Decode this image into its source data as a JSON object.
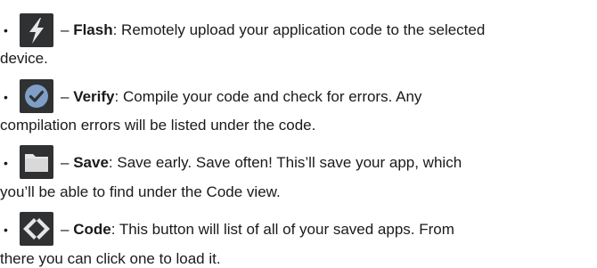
{
  "items": [
    {
      "icon": "lightning-bolt-icon",
      "dash": "–",
      "name": "Flash",
      "line1_rest": ": Remotely upload your application code to the selected",
      "line2": "device."
    },
    {
      "icon": "checkmark-circle-icon",
      "dash": "–",
      "name": "Verify",
      "line1_rest": ": Compile your code and check for errors. Any",
      "line2": "compilation errors will be listed under the code."
    },
    {
      "icon": "folder-icon",
      "dash": "–",
      "name": "Save",
      "line1_rest": ": Save early. Save often! This’ll save your app, which",
      "line2": "you’ll be able to find under the Code view."
    },
    {
      "icon": "code-brackets-icon",
      "dash": "–",
      "name": "Code",
      "line1_rest": ": This button will list of all of your saved apps. From",
      "line2": "there you can click one to load it."
    }
  ],
  "colors": {
    "icon_bg": "#2f3133",
    "flash_icon": "#e8e8e8",
    "verify_icon": "#7f9fc6",
    "save_icon": "#e6e6e6",
    "code_icon": "#e6e6e6"
  }
}
